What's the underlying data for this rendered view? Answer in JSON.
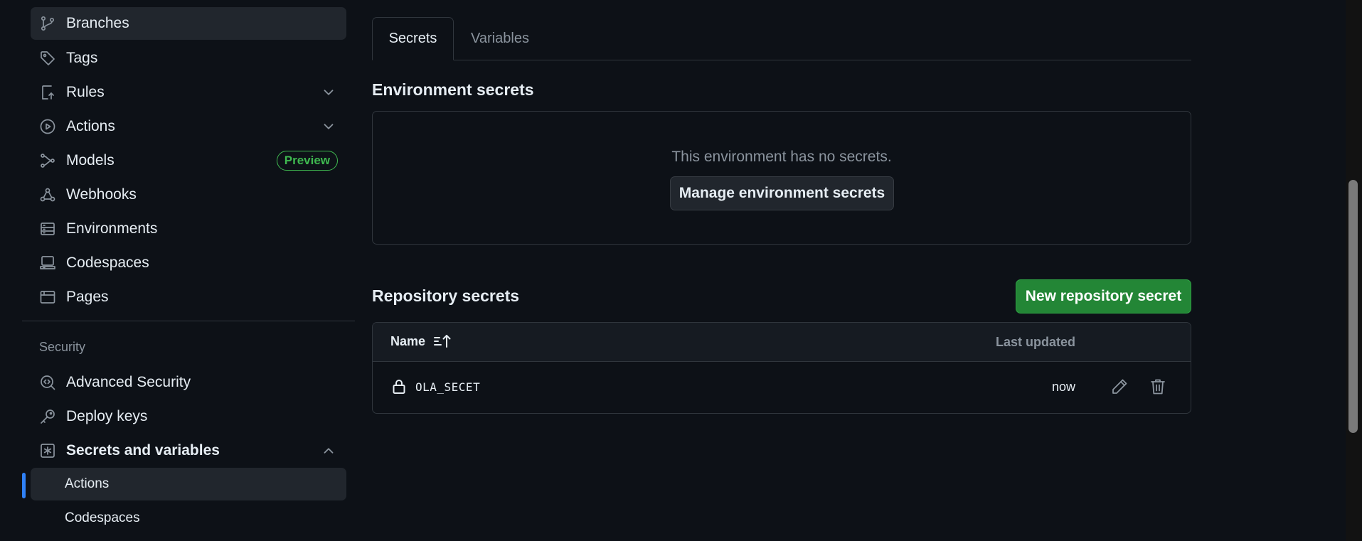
{
  "sidebar": {
    "items": [
      {
        "label": "Branches",
        "icon": "git-branch-icon"
      },
      {
        "label": "Tags",
        "icon": "tag-icon"
      },
      {
        "label": "Rules",
        "icon": "rules-icon"
      },
      {
        "label": "Actions",
        "icon": "play-icon"
      },
      {
        "label": "Models",
        "icon": "models-icon",
        "badge": "Preview"
      },
      {
        "label": "Webhooks",
        "icon": "webhook-icon"
      },
      {
        "label": "Environments",
        "icon": "server-icon"
      },
      {
        "label": "Codespaces",
        "icon": "codespaces-icon"
      },
      {
        "label": "Pages",
        "icon": "browser-icon"
      }
    ],
    "section_label": "Security",
    "security_items": [
      {
        "label": "Advanced Security",
        "icon": "codescan-icon"
      },
      {
        "label": "Deploy keys",
        "icon": "key-icon"
      },
      {
        "label": "Secrets and variables",
        "icon": "asterisk-icon"
      }
    ],
    "sub_items": [
      {
        "label": "Actions"
      },
      {
        "label": "Codespaces"
      }
    ]
  },
  "tabs": [
    {
      "label": "Secrets"
    },
    {
      "label": "Variables"
    }
  ],
  "environment": {
    "title": "Environment secrets",
    "empty_text": "This environment has no secrets.",
    "manage_button": "Manage environment secrets"
  },
  "repository": {
    "title": "Repository secrets",
    "new_button": "New repository secret",
    "columns": {
      "name": "Name",
      "updated": "Last updated"
    },
    "rows": [
      {
        "name": "OLA_SECET",
        "updated": "now"
      }
    ]
  },
  "colors": {
    "background": "#0d1117",
    "primary_button": "#238636",
    "accent": "#2f81f7",
    "badge": "#3fb950"
  }
}
